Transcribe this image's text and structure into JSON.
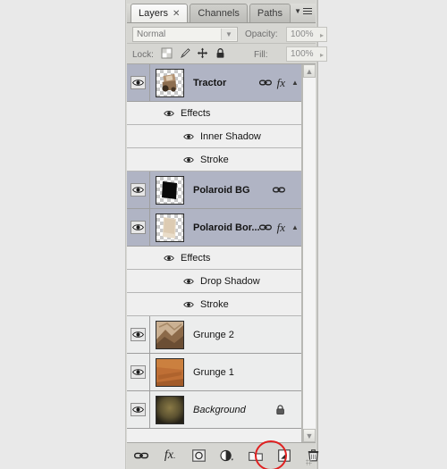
{
  "window": {
    "minimize_label": "−",
    "close_label": "×"
  },
  "tabs": [
    {
      "label": "Layers",
      "active": true,
      "closable": true
    },
    {
      "label": "Channels",
      "active": false,
      "closable": false
    },
    {
      "label": "Paths",
      "active": false,
      "closable": false
    }
  ],
  "options": {
    "blend_mode": "Normal",
    "blend_mode_placeholder": "Normal",
    "opacity_label": "Opacity:",
    "opacity_value": "100%",
    "fill_label": "Fill:",
    "fill_value": "100%",
    "lock_label": "Lock:",
    "lock_icons": [
      "lock-transparent-pixels-icon",
      "lock-image-pixels-icon",
      "lock-position-icon",
      "lock-all-icon"
    ]
  },
  "layers": [
    {
      "name": "Tractor",
      "visible": true,
      "selected": true,
      "bold": true,
      "italic": false,
      "linked": true,
      "has_fx": true,
      "locked": false,
      "expanded": true,
      "thumb_type": "transparent-tractor",
      "effects_label": "Effects",
      "effects": [
        "Inner Shadow",
        "Stroke"
      ]
    },
    {
      "name": "Polaroid BG",
      "visible": true,
      "selected": true,
      "bold": true,
      "italic": false,
      "linked": true,
      "has_fx": false,
      "locked": false,
      "expanded": false,
      "thumb_type": "transparent-black-polaroid",
      "effects_label": "",
      "effects": []
    },
    {
      "name": "Polaroid Bor...",
      "visible": true,
      "selected": true,
      "bold": true,
      "italic": false,
      "linked": true,
      "has_fx": true,
      "locked": false,
      "expanded": true,
      "thumb_type": "transparent-paper",
      "effects_label": "Effects",
      "effects": [
        "Drop Shadow",
        "Stroke"
      ]
    },
    {
      "name": "Grunge 2",
      "visible": true,
      "selected": false,
      "bold": false,
      "italic": false,
      "linked": false,
      "has_fx": false,
      "locked": false,
      "expanded": false,
      "thumb_type": "grunge-light",
      "effects_label": "",
      "effects": []
    },
    {
      "name": "Grunge 1",
      "visible": true,
      "selected": false,
      "bold": false,
      "italic": false,
      "linked": false,
      "has_fx": false,
      "locked": false,
      "expanded": false,
      "thumb_type": "grunge-orange",
      "effects_label": "",
      "effects": []
    },
    {
      "name": "Background",
      "visible": true,
      "selected": false,
      "bold": false,
      "italic": true,
      "linked": false,
      "has_fx": false,
      "locked": true,
      "expanded": false,
      "thumb_type": "dark-olive",
      "effects_label": "",
      "effects": []
    }
  ],
  "bottom_toolbar": {
    "buttons": [
      {
        "name": "link-layers-icon",
        "label": "Link layers"
      },
      {
        "name": "layer-style-fx-icon",
        "label": "Add a layer style"
      },
      {
        "name": "layer-mask-icon",
        "label": "Add layer mask"
      },
      {
        "name": "adjustment-layer-icon",
        "label": "Create new fill or adjustment layer"
      },
      {
        "name": "new-group-folder-icon",
        "label": "Create a new group"
      },
      {
        "name": "new-layer-icon",
        "label": "Create a new layer"
      },
      {
        "name": "delete-layer-trash-icon",
        "label": "Delete layer"
      }
    ],
    "highlighted_button": "new-layer-icon"
  },
  "scrollbar": {
    "up_arrow": "▲",
    "down_arrow": "▼"
  },
  "colors": {
    "panel_bg": "#d6d6d2",
    "list_bg": "#f0f0f0",
    "selected_row": "#b0b4c4",
    "highlight_ring": "#e02020",
    "text": "#141414"
  }
}
